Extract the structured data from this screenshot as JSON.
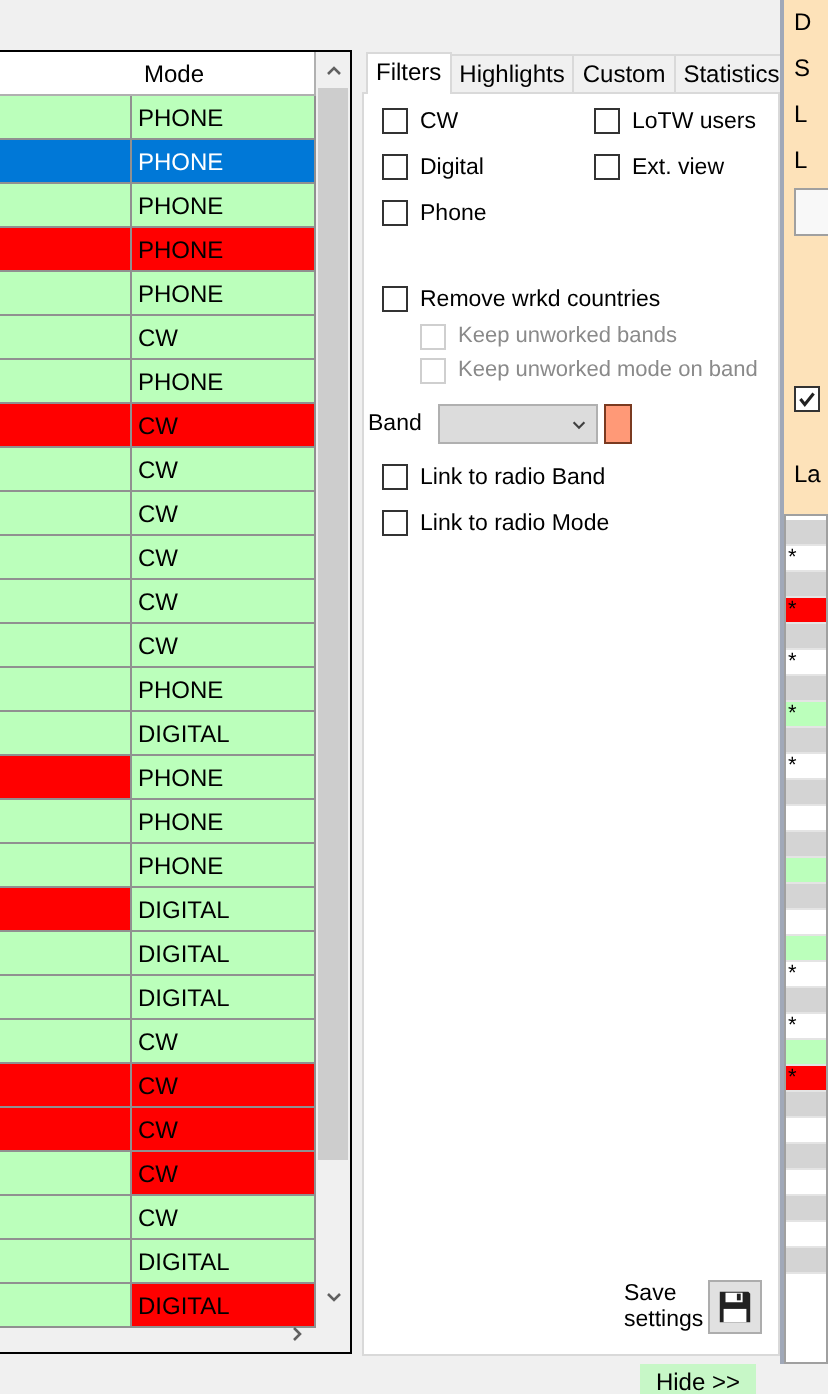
{
  "table": {
    "columns": [
      "Mode"
    ],
    "rows": [
      {
        "selected": false,
        "cells": [
          {
            "color": "#bbffbb"
          },
          {
            "text": "PHONE",
            "color": "#bbffbb"
          }
        ]
      },
      {
        "selected": true,
        "cells": [
          {},
          {
            "text": "PHONE"
          }
        ]
      },
      {
        "selected": false,
        "cells": [
          {
            "color": "#bbffbb"
          },
          {
            "text": "PHONE",
            "color": "#bbffbb"
          }
        ]
      },
      {
        "selected": false,
        "cells": [
          {
            "color": "#ff0000"
          },
          {
            "text": "PHONE",
            "color": "#ff0000"
          }
        ]
      },
      {
        "selected": false,
        "cells": [
          {
            "color": "#bbffbb"
          },
          {
            "text": "PHONE",
            "color": "#bbffbb"
          }
        ]
      },
      {
        "selected": false,
        "cells": [
          {
            "color": "#bbffbb"
          },
          {
            "text": "CW",
            "color": "#bbffbb"
          }
        ]
      },
      {
        "selected": false,
        "cells": [
          {
            "color": "#bbffbb"
          },
          {
            "text": "PHONE",
            "color": "#bbffbb"
          }
        ]
      },
      {
        "selected": false,
        "cells": [
          {
            "color": "#ff0000"
          },
          {
            "text": "CW",
            "color": "#ff0000"
          }
        ]
      },
      {
        "selected": false,
        "cells": [
          {
            "color": "#bbffbb"
          },
          {
            "text": "CW",
            "color": "#bbffbb"
          }
        ]
      },
      {
        "selected": false,
        "cells": [
          {
            "color": "#bbffbb"
          },
          {
            "text": "CW",
            "color": "#bbffbb"
          }
        ]
      },
      {
        "selected": false,
        "cells": [
          {
            "color": "#bbffbb"
          },
          {
            "text": "CW",
            "color": "#bbffbb"
          }
        ]
      },
      {
        "selected": false,
        "cells": [
          {
            "color": "#bbffbb"
          },
          {
            "text": "CW",
            "color": "#bbffbb"
          }
        ]
      },
      {
        "selected": false,
        "cells": [
          {
            "color": "#bbffbb"
          },
          {
            "text": "CW",
            "color": "#bbffbb"
          }
        ]
      },
      {
        "selected": false,
        "cells": [
          {
            "color": "#bbffbb"
          },
          {
            "text": "PHONE",
            "color": "#bbffbb"
          }
        ]
      },
      {
        "selected": false,
        "cells": [
          {
            "color": "#bbffbb"
          },
          {
            "text": "DIGITAL",
            "color": "#bbffbb"
          }
        ]
      },
      {
        "selected": false,
        "cells": [
          {
            "color": "#ff0000"
          },
          {
            "text": "PHONE",
            "color": "#bbffbb"
          }
        ]
      },
      {
        "selected": false,
        "cells": [
          {
            "color": "#bbffbb"
          },
          {
            "text": "PHONE",
            "color": "#bbffbb"
          }
        ]
      },
      {
        "selected": false,
        "cells": [
          {
            "color": "#bbffbb"
          },
          {
            "text": "PHONE",
            "color": "#bbffbb"
          }
        ]
      },
      {
        "selected": false,
        "cells": [
          {
            "color": "#ff0000"
          },
          {
            "text": "DIGITAL",
            "color": "#bbffbb"
          }
        ]
      },
      {
        "selected": false,
        "cells": [
          {
            "color": "#bbffbb"
          },
          {
            "text": "DIGITAL",
            "color": "#bbffbb"
          }
        ]
      },
      {
        "selected": false,
        "cells": [
          {
            "color": "#bbffbb"
          },
          {
            "text": "DIGITAL",
            "color": "#bbffbb"
          }
        ]
      },
      {
        "selected": false,
        "cells": [
          {
            "color": "#bbffbb"
          },
          {
            "text": "CW",
            "color": "#bbffbb"
          }
        ]
      },
      {
        "selected": false,
        "cells": [
          {
            "color": "#ff0000"
          },
          {
            "text": "CW",
            "color": "#ff0000"
          }
        ]
      },
      {
        "selected": false,
        "cells": [
          {
            "color": "#ff0000"
          },
          {
            "text": "CW",
            "color": "#ff0000"
          }
        ]
      },
      {
        "selected": false,
        "cells": [
          {
            "color": "#bbffbb"
          },
          {
            "text": "CW",
            "color": "#ff0000"
          }
        ]
      },
      {
        "selected": false,
        "cells": [
          {
            "color": "#bbffbb"
          },
          {
            "text": "CW",
            "color": "#bbffbb"
          }
        ]
      },
      {
        "selected": false,
        "cells": [
          {
            "color": "#bbffbb"
          },
          {
            "text": "DIGITAL",
            "color": "#bbffbb"
          }
        ]
      },
      {
        "selected": false,
        "cells": [
          {
            "color": "#bbffbb"
          },
          {
            "text": "DIGITAL",
            "color": "#ff0000"
          }
        ]
      }
    ]
  },
  "tabs": [
    {
      "label": "Filters",
      "selected": true
    },
    {
      "label": "Highlights",
      "selected": false
    },
    {
      "label": "Custom",
      "selected": false
    },
    {
      "label": "Statistics",
      "selected": false
    }
  ],
  "filters": {
    "mode_checks": [
      {
        "label": "CW",
        "checked": false
      },
      {
        "label": "Digital",
        "checked": false
      },
      {
        "label": "Phone",
        "checked": false
      }
    ],
    "view_checks": [
      {
        "label": "LoTW users",
        "checked": false
      },
      {
        "label": "Ext. view",
        "checked": false
      }
    ],
    "remove_worked": {
      "label": "Remove wrkd countries",
      "checked": false
    },
    "sub_checks": [
      {
        "label": "Keep unworked bands",
        "checked": false,
        "disabled": true
      },
      {
        "label": "Keep unworked mode on band",
        "checked": false,
        "disabled": true
      }
    ],
    "band": {
      "label": "Band",
      "swatch": {
        "color": "#ff9977"
      }
    },
    "link_checks": [
      {
        "label": "Link to radio Band",
        "checked": false
      },
      {
        "label": "Link to radio Mode",
        "checked": false
      }
    ],
    "save_label": "Save settings"
  },
  "hide_button": "Hide >>",
  "side_panel": {
    "labels": [
      "D",
      "S",
      "L",
      "L"
    ],
    "option_checked": true,
    "list_label": "La",
    "rows": [
      {
        "color": "#d4d4d4"
      },
      {
        "color": "#ffffff",
        "text": "*"
      },
      {
        "color": "#d4d4d4"
      },
      {
        "color": "#ff0000",
        "text": "*"
      },
      {
        "color": "#d4d4d4"
      },
      {
        "color": "#ffffff",
        "text": "*"
      },
      {
        "color": "#d4d4d4"
      },
      {
        "color": "#bbffbb",
        "text": "*"
      },
      {
        "color": "#d4d4d4"
      },
      {
        "color": "#ffffff",
        "text": "*"
      },
      {
        "color": "#d4d4d4"
      },
      {
        "color": "#ffffff"
      },
      {
        "color": "#d4d4d4"
      },
      {
        "color": "#bbffbb"
      },
      {
        "color": "#d4d4d4"
      },
      {
        "color": "#ffffff"
      },
      {
        "color": "#bbffbb"
      },
      {
        "color": "#ffffff",
        "text": "*"
      },
      {
        "color": "#d4d4d4"
      },
      {
        "color": "#ffffff",
        "text": "*"
      },
      {
        "color": "#bbffbb"
      },
      {
        "color": "#ff0000",
        "text": "*"
      },
      {
        "color": "#d4d4d4"
      },
      {
        "color": "#ffffff"
      },
      {
        "color": "#d4d4d4"
      },
      {
        "color": "#ffffff"
      },
      {
        "color": "#d4d4d4"
      },
      {
        "color": "#ffffff"
      },
      {
        "color": "#d4d4d4"
      }
    ]
  }
}
